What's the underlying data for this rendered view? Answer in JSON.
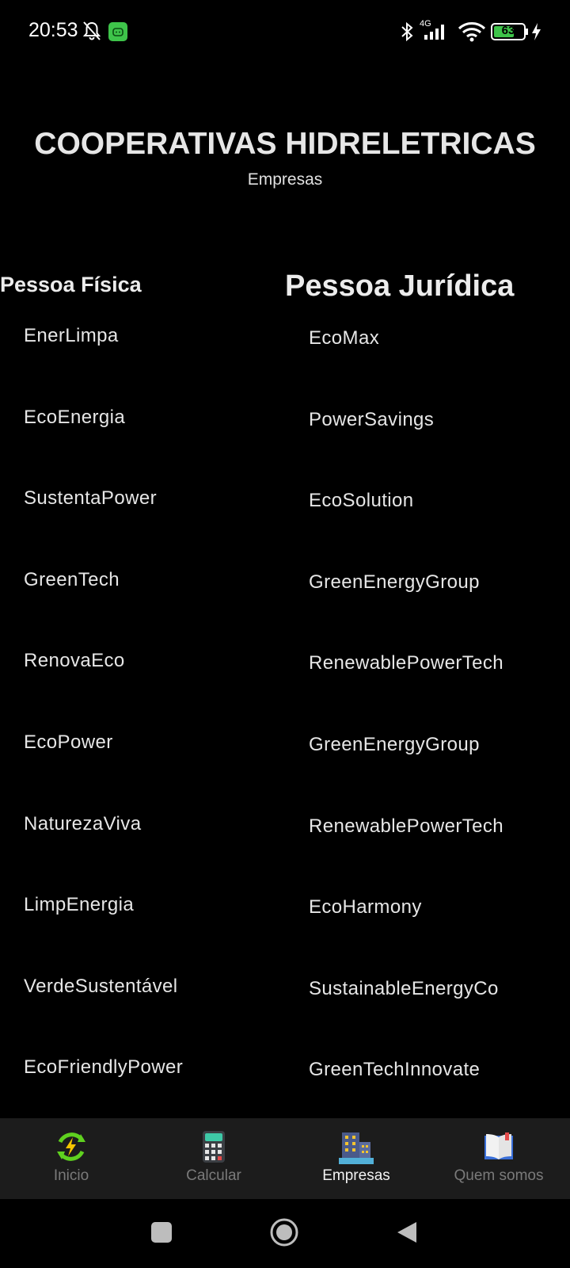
{
  "status_bar": {
    "time": "20:53",
    "network_label": "4G",
    "battery_level": "63",
    "icons": [
      "bell-off-icon",
      "app-notification-icon",
      "bluetooth-icon",
      "signal-icon",
      "wifi-icon",
      "battery-icon",
      "charging-icon"
    ]
  },
  "header": {
    "title": "COOPERATIVAS HIDRELETRICAS",
    "subtitle": "Empresas"
  },
  "columns": {
    "pessoa_fisica": {
      "heading": "Pessoa Física",
      "items": [
        "EnerLimpa",
        "EcoEnergia",
        "SustentaPower",
        "GreenTech",
        "RenovaEco",
        "EcoPower",
        "NaturezaViva",
        "LimpEnergia",
        "VerdeSustentável",
        "EcoFriendlyPower"
      ]
    },
    "pessoa_juridica": {
      "heading": "Pessoa Jurídica",
      "items": [
        "EcoMax",
        "PowerSavings",
        "EcoSolution",
        "GreenEnergyGroup",
        "RenewablePowerTech",
        "GreenEnergyGroup",
        "RenewablePowerTech",
        "EcoHarmony",
        "SustainableEnergyCo",
        "GreenTechInnovate"
      ]
    }
  },
  "bottom_nav": {
    "items": [
      {
        "label": "Inicio",
        "icon": "energy-refresh-icon",
        "active": false
      },
      {
        "label": "Calcular",
        "icon": "calculator-icon",
        "active": false
      },
      {
        "label": "Empresas",
        "icon": "buildings-icon",
        "active": true
      },
      {
        "label": "Quem somos",
        "icon": "book-icon",
        "active": false
      }
    ]
  },
  "system_nav": {
    "icons": [
      "recents-square-icon",
      "home-circle-icon",
      "back-triangle-icon"
    ]
  }
}
